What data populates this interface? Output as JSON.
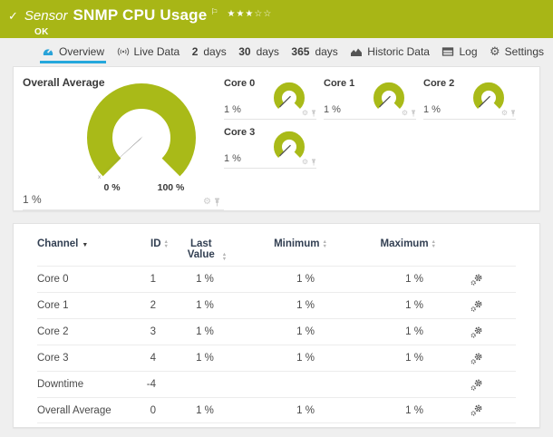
{
  "colors": {
    "header_green": "#a8b616",
    "gauge_green": "#a9ba18",
    "accent_blue": "#26a8dc",
    "table_header_text": "#323f52"
  },
  "header": {
    "kind": "Sensor",
    "title": "SNMP CPU Usage",
    "status": "OK",
    "rating_filled": "★★★",
    "rating_empty": "☆☆"
  },
  "tabs": {
    "overview": {
      "label": "Overview",
      "icon": "gauge-icon"
    },
    "live_data": {
      "label": "Live Data",
      "icon": "broadcast-icon"
    },
    "d2": {
      "num": "2",
      "unit": "days"
    },
    "d30": {
      "num": "30",
      "unit": "days"
    },
    "d365": {
      "num": "365",
      "unit": "days"
    },
    "historic": {
      "label": "Historic Data",
      "icon": "area-chart-icon"
    },
    "log": {
      "label": "Log",
      "icon": "log-table-icon"
    },
    "settings": {
      "label": "Settings",
      "icon": "gear-icon"
    }
  },
  "overview": {
    "main_gauge": {
      "title": "Overall Average",
      "value": "1 %",
      "scale_min": "0 %",
      "scale_max": "100 %",
      "marker": "x"
    },
    "cores": [
      {
        "title": "Core 0",
        "value": "1 %"
      },
      {
        "title": "Core 1",
        "value": "1 %"
      },
      {
        "title": "Core 2",
        "value": "1 %"
      },
      {
        "title": "Core 3",
        "value": "1 %"
      }
    ]
  },
  "table": {
    "headers": {
      "channel": "Channel",
      "id": "ID",
      "last_value": "Last Value",
      "minimum": "Minimum",
      "maximum": "Maximum"
    },
    "rows": [
      {
        "channel": "Core 0",
        "id": "1",
        "last": "1 %",
        "min": "1 %",
        "max": "1 %"
      },
      {
        "channel": "Core 1",
        "id": "2",
        "last": "1 %",
        "min": "1 %",
        "max": "1 %"
      },
      {
        "channel": "Core 2",
        "id": "3",
        "last": "1 %",
        "min": "1 %",
        "max": "1 %"
      },
      {
        "channel": "Core 3",
        "id": "4",
        "last": "1 %",
        "min": "1 %",
        "max": "1 %"
      },
      {
        "channel": "Downtime",
        "id": "-4",
        "last": "",
        "min": "",
        "max": ""
      },
      {
        "channel": "Overall Average",
        "id": "0",
        "last": "1 %",
        "min": "1 %",
        "max": "1 %"
      }
    ]
  }
}
